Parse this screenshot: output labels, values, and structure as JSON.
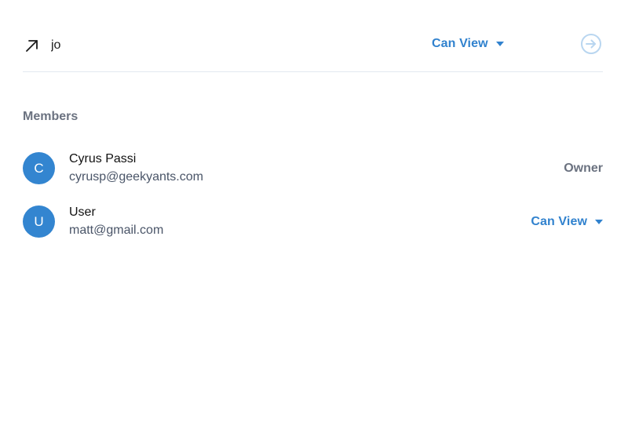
{
  "invite": {
    "input_value": "jo",
    "permission_label": "Can View"
  },
  "members": {
    "heading": "Members",
    "items": [
      {
        "initial": "C",
        "name": "Cyrus Passi",
        "email": "cyrusp@geekyants.com",
        "role": "Owner"
      },
      {
        "initial": "U",
        "name": "User",
        "email": "matt@gmail.com",
        "permission_label": "Can View"
      }
    ]
  },
  "colors": {
    "accent": "#3182ce",
    "avatar": "#3385d0",
    "muted": "#6b7280",
    "send_icon": "#b9d6f0",
    "divider": "#e2e8f0"
  },
  "icons": {
    "invite": "arrow-up-right-icon",
    "send": "arrow-right-circle-icon",
    "dropdown": "caret-down-icon"
  }
}
